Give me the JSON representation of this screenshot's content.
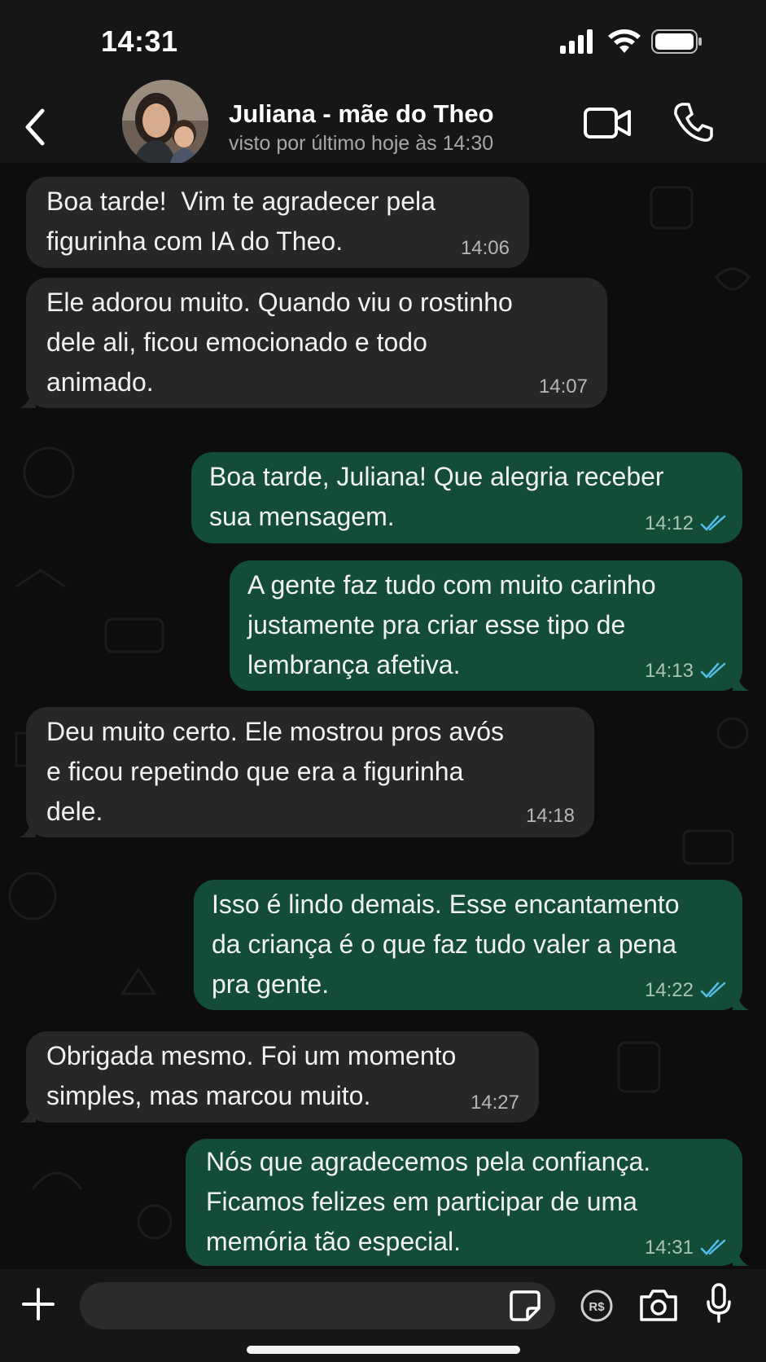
{
  "status_bar": {
    "time": "14:31"
  },
  "header": {
    "contact_name": "Juliana - mãe do Theo",
    "contact_status": "visto por último hoje às 14:30"
  },
  "messages": [
    {
      "direction": "incoming",
      "text": "Boa tarde!  Vim te agradecer pela\nfigurinha com IA do Theo.",
      "time": "14:06"
    },
    {
      "direction": "incoming",
      "text": "Ele adorou muito. Quando viu o rostinho\ndele ali, ficou emocionado e todo\nanimado.",
      "time": "14:07"
    },
    {
      "direction": "outgoing",
      "text": "Boa tarde, Juliana! Que alegria receber\nsua mensagem.",
      "time": "14:12",
      "status": "read"
    },
    {
      "direction": "outgoing",
      "text": "A gente faz tudo com muito carinho\njustamente pra criar esse tipo de\nlembrança afetiva.",
      "time": "14:13",
      "status": "read"
    },
    {
      "direction": "incoming",
      "text": "Deu muito certo. Ele mostrou pros avós\ne ficou repetindo que era a figurinha\ndele.",
      "time": "14:18"
    },
    {
      "direction": "outgoing",
      "text": "Isso é lindo demais. Esse encantamento\nda criança é o que faz tudo valer a pena\npra gente.",
      "time": "14:22",
      "status": "read"
    },
    {
      "direction": "incoming",
      "text": "Obrigada mesmo. Foi um momento\nsimples, mas marcou muito.",
      "time": "14:27"
    },
    {
      "direction": "outgoing",
      "text": "Nós que agradecemos pela confiança.\nFicamos felizes em participar de uma\nmemória tão especial.",
      "time": "14:31",
      "status": "read"
    }
  ],
  "input": {
    "placeholder": ""
  },
  "icons": {
    "back": "chevron-left-icon",
    "video": "video-camera-icon",
    "call": "phone-icon",
    "plus": "plus-icon",
    "sticker": "sticker-icon",
    "pay": "payment-icon",
    "camera": "camera-icon",
    "mic": "microphone-icon",
    "read_receipt": "double-check-icon"
  },
  "colors": {
    "incoming_bubble": "#272727",
    "outgoing_bubble": "#134d37",
    "read_receipt": "#53bdeb",
    "header_bg": "#161616"
  }
}
